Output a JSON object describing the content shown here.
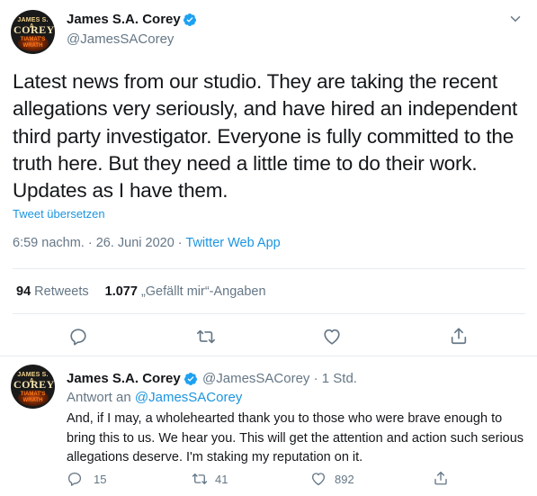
{
  "avatar": {
    "line1": "JAMES S. A.",
    "line2": "COREY",
    "line3": "TIAMAT'S WRATH"
  },
  "main_tweet": {
    "author_name": "James S.A. Corey",
    "handle": "@JamesSACorey",
    "text": "Latest news from our studio. They are taking the recent allegations very seriously, and have hired an independent third party investigator. Everyone is fully committed to the truth here. But they need a little time to do their work. Updates as I have them.",
    "translate_label": "Tweet übersetzen",
    "time": "6:59 nachm.",
    "date": "26. Juni 2020",
    "app": "Twitter Web App",
    "retweet_count": "94",
    "retweet_label": "Retweets",
    "like_count": "1.077",
    "like_label": "„Gefällt mir“-Angaben"
  },
  "reply_tweet": {
    "author_name": "James S.A. Corey",
    "handle": "@JamesSACorey",
    "time": "1 Std.",
    "reply_to_label": "Antwort an",
    "reply_to_handle": "@JamesSACorey",
    "text": "And, if I may, a wholehearted thank you to those who were brave enough to bring this to us. We hear you. This will get the attention and action such serious allegations deserve. I'm staking my reputation on it.",
    "reply_count": "15",
    "retweet_count": "41",
    "like_count": "892"
  },
  "colors": {
    "accent": "#1b95e0",
    "verified": "#1da1f2",
    "muted": "#657786",
    "text": "#14171a",
    "border": "#e6ecf0"
  },
  "icons": [
    "verified-icon",
    "chevron-down-icon",
    "reply-icon",
    "retweet-icon",
    "heart-icon",
    "share-icon"
  ]
}
